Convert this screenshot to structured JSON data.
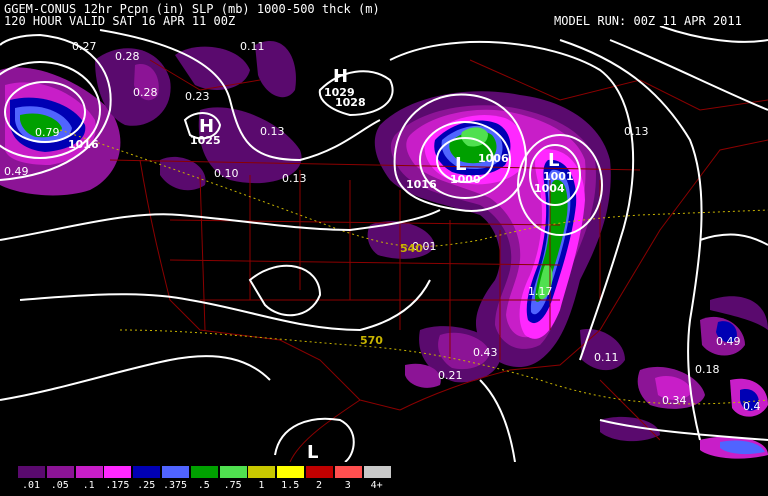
{
  "header": {
    "title_line1": "GGEM-CONUS 12hr Pcpn (in) SLP (mb) 1000-500 thck (m)",
    "title_line2": "120 HOUR VALID SAT 16 APR 11 00Z",
    "model_run": "MODEL RUN: 00Z 11 APR 2011"
  },
  "colors": {
    "background": "#000000",
    "borders": "#8b0000",
    "isobars": "#ffffff",
    "thickness": "#c8b400",
    "pcpn_01": "#5a0a6e",
    "pcpn_05": "#8c1496",
    "pcpn_1": "#c81ec8",
    "pcpn_175": "#ff28ff",
    "pcpn_25": "#0000b4",
    "pcpn_375": "#5064ff",
    "pcpn_5": "#00a000",
    "pcpn_75": "#50e050",
    "pcpn_1in": "#c8c800",
    "pcpn_15": "#ffff00",
    "pcpn_2": "#c00000",
    "pcpn_3": "#ff5050",
    "pcpn_4": "#c8c8c8"
  },
  "pressure_centers": [
    {
      "type": "H",
      "value": "1029",
      "value2": "1028"
    },
    {
      "type": "H",
      "value": "1025"
    },
    {
      "type": "L",
      "value": "1000",
      "value2": "1006"
    },
    {
      "type": "L",
      "value": "1004",
      "value2": "1001"
    },
    {
      "type": "L",
      "value": ""
    },
    {
      "type": "",
      "value": "1016"
    },
    {
      "type": "",
      "value": "1016"
    }
  ],
  "precip_labels": [
    "0.27",
    "0.28",
    "0.28",
    "0.23",
    "0.11",
    "0.13",
    "0.79",
    "0.49",
    "0.10",
    "0.13",
    "0.01",
    "1.17",
    "0.43",
    "0.21",
    "0.11",
    "0.13",
    "0.49",
    "0.18",
    "0.34",
    "0.4"
  ],
  "thickness_labels": [
    "540",
    "570"
  ],
  "legend": {
    "items": [
      {
        "label": ".01",
        "color": "#5a0a6e"
      },
      {
        "label": ".05",
        "color": "#8c1496"
      },
      {
        "label": ".1",
        "color": "#c81ec8"
      },
      {
        "label": ".175",
        "color": "#ff28ff"
      },
      {
        "label": ".25",
        "color": "#0000b4"
      },
      {
        "label": ".375",
        "color": "#5064ff"
      },
      {
        "label": ".5",
        "color": "#00a000"
      },
      {
        "label": ".75",
        "color": "#50e050"
      },
      {
        "label": "1",
        "color": "#c8c800"
      },
      {
        "label": "1.5",
        "color": "#ffff00"
      },
      {
        "label": "2",
        "color": "#c00000"
      },
      {
        "label": "3",
        "color": "#ff5050"
      },
      {
        "label": "4+",
        "color": "#c8c8c8"
      }
    ]
  }
}
